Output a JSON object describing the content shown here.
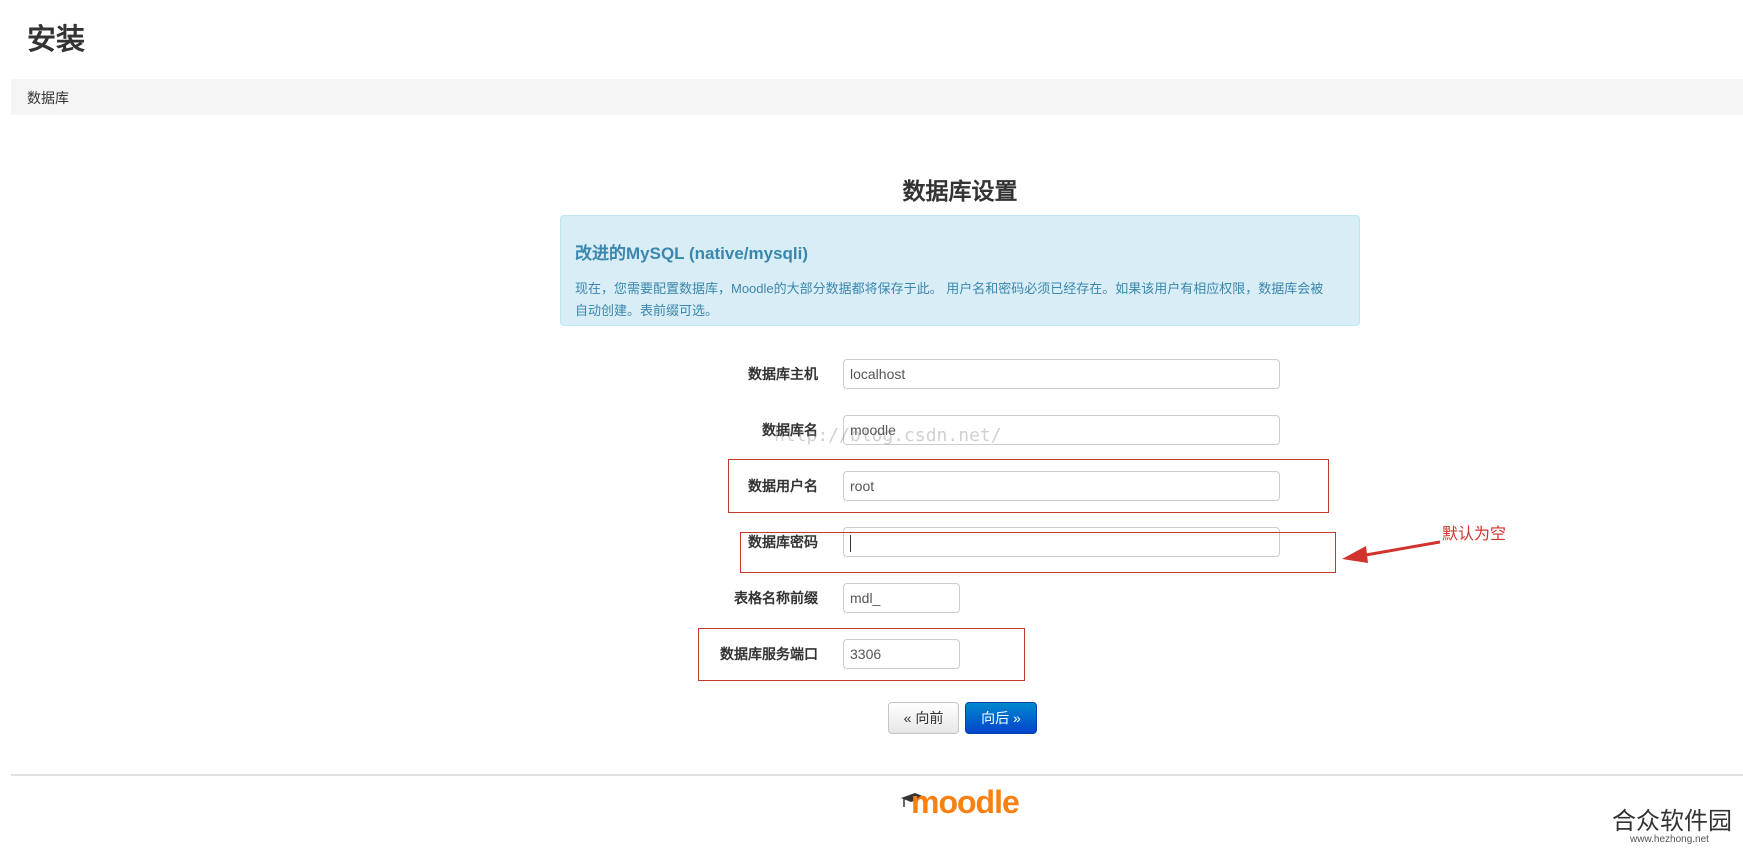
{
  "page": {
    "title": "安装",
    "breadcrumb": "数据库"
  },
  "section": {
    "title": "数据库设置"
  },
  "info": {
    "heading": "改进的MySQL (native/mysqli)",
    "text": "现在，您需要配置数据库，Moodle的大部分数据都将保存于此。 用户名和密码必须已经存在。如果该用户有相应权限，数据库会被自动创建。表前缀可选。"
  },
  "form": {
    "fields": [
      {
        "label": "数据库主机",
        "value": "localhost"
      },
      {
        "label": "数据库名",
        "value": "moodle"
      },
      {
        "label": "数据用户名",
        "value": "root"
      },
      {
        "label": "数据库密码",
        "value": ""
      },
      {
        "label": "表格名称前缀",
        "value": "mdl_"
      },
      {
        "label": "数据库服务端口",
        "value": "3306"
      }
    ]
  },
  "buttons": {
    "prev": "« 向前",
    "next": "向后 »"
  },
  "annotation": {
    "text": "默认为空",
    "color": "#d0342c"
  },
  "watermark": "http://blog.csdn.net/",
  "footer": {
    "logo_text": "moodle",
    "site_name": "合众软件园",
    "site_url": "www.hezhong.net"
  },
  "colors": {
    "info_bg": "#d9edf7",
    "info_text": "#3a87ad",
    "primary_button": "#0044cc",
    "moodle_orange": "#f98012"
  }
}
